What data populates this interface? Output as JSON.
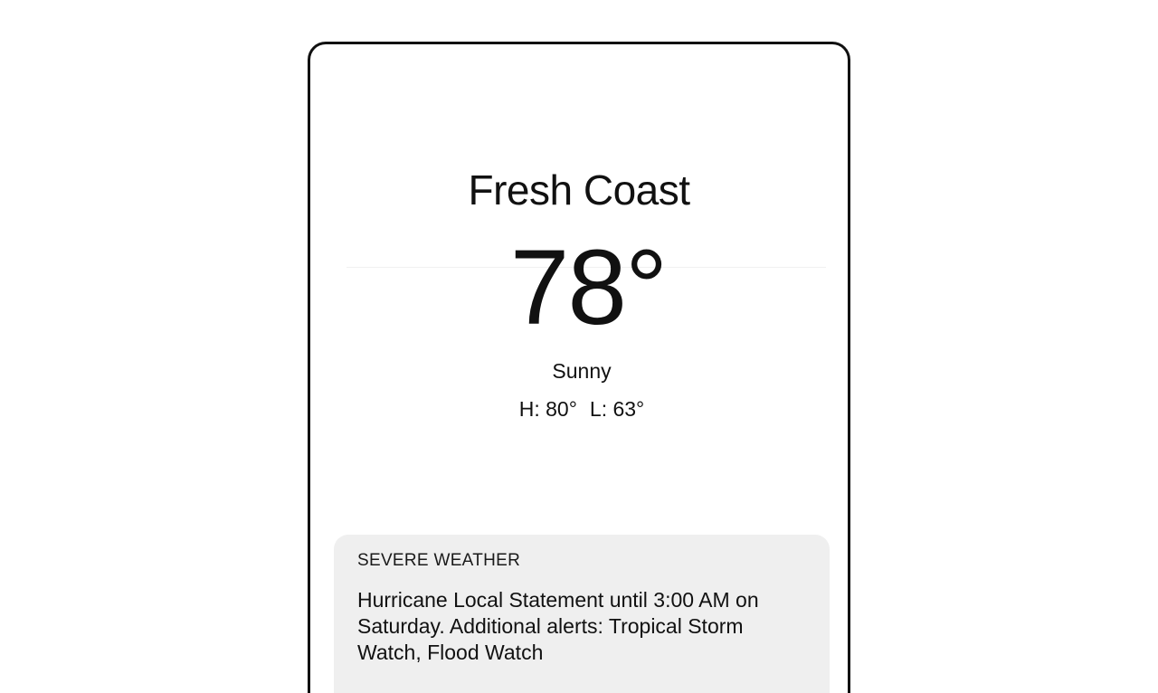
{
  "weather": {
    "location": "Fresh Coast",
    "temperature": "78°",
    "condition": "Sunny",
    "high": "H: 80°",
    "low": "L: 63°"
  },
  "alert": {
    "title": "SEVERE WEATHER",
    "message": "Hurricane Local Statement until 3:00 AM on Saturday. Additional alerts: Tropical Storm Watch, Flood Watch"
  },
  "colors": {
    "card_background": "#efefef",
    "frame_border": "#111111",
    "text": "#111111"
  }
}
